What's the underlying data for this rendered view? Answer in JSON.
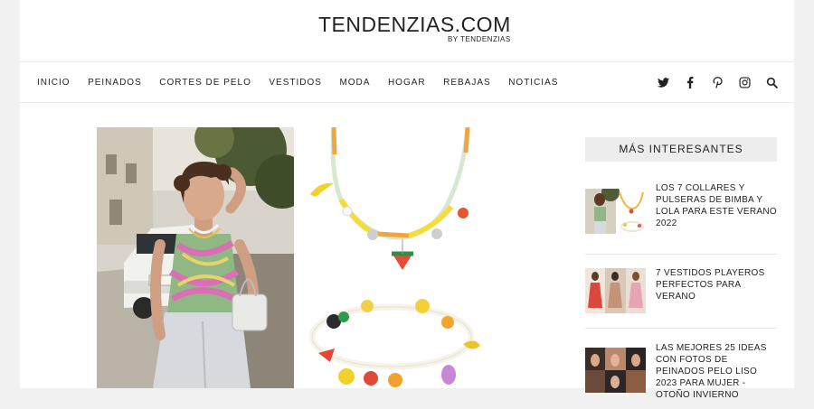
{
  "site": {
    "title": "TENDENZIAS.COM",
    "byline": "BY TENDENZIAS"
  },
  "nav": {
    "items": [
      "INICIO",
      "PEINADOS",
      "CORTES DE PELO",
      "VESTIDOS",
      "MODA",
      "HOGAR",
      "REBAJAS",
      "NOTICIAS"
    ],
    "icons": [
      "twitter-icon",
      "facebook-icon",
      "pinterest-icon",
      "instagram-icon",
      "search-icon"
    ]
  },
  "sidebar": {
    "title": "MÁS INTERESANTES",
    "items": [
      {
        "title": "LOS 7 COLLARES Y PULSERAS DE BIMBA Y LOLA PARA ESTE VERANO 2022"
      },
      {
        "title": "7 VESTIDOS PLAYEROS PERFECTOS PARA VERANO"
      },
      {
        "title": "LAS MEJORES 25 IDEAS CON FOTOS DE PEINADOS PELO LISO 2023 PARA MUJER - OTOÑO INVIERNO"
      }
    ]
  },
  "colors": {
    "accent": "#222222",
    "sidebar_header_bg": "#ededed"
  }
}
